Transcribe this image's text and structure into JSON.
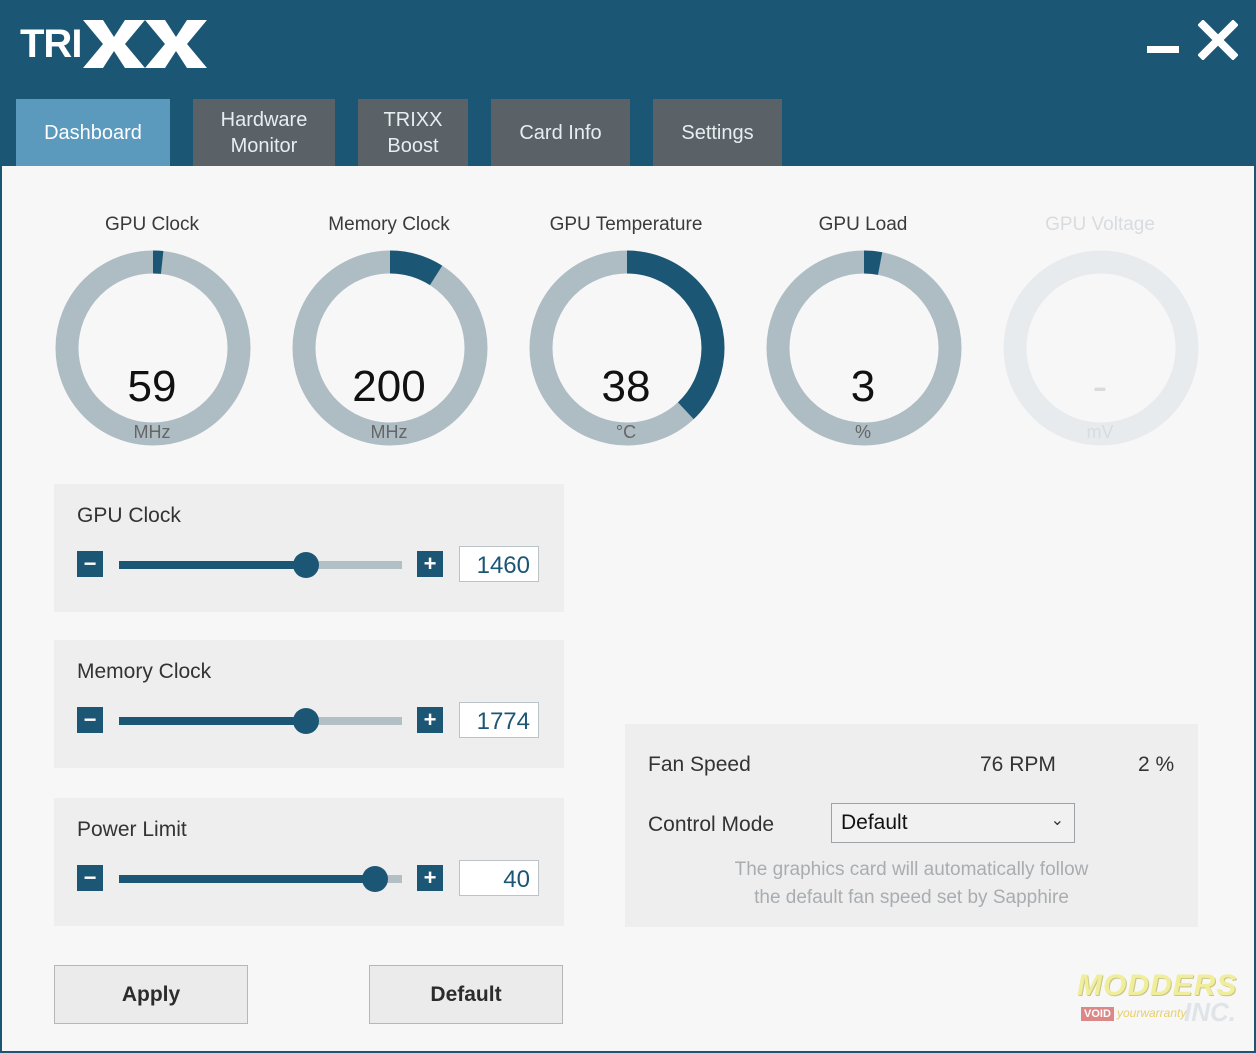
{
  "app": {
    "logo_text": "TRI",
    "logo_xx": "XX"
  },
  "window_controls": {
    "minimize_icon": "minimize-icon",
    "close_icon": "close-icon"
  },
  "tabs": [
    {
      "label": "Dashboard",
      "active": true
    },
    {
      "label": "Hardware\nMonitor",
      "active": false
    },
    {
      "label": "TRIXX\nBoost",
      "active": false
    },
    {
      "label": "Card Info",
      "active": false
    },
    {
      "label": "Settings",
      "active": false
    }
  ],
  "gauges": [
    {
      "title": "GPU Clock",
      "value": "59",
      "unit": "MHz",
      "fraction": 0.017
    },
    {
      "title": "Memory Clock",
      "value": "200",
      "unit": "MHz",
      "fraction": 0.09
    },
    {
      "title": "GPU Temperature",
      "value": "38",
      "unit": "°C",
      "fraction": 0.38
    },
    {
      "title": "GPU Load",
      "value": "3",
      "unit": "%",
      "fraction": 0.03
    },
    {
      "title": "GPU Voltage",
      "value": "-",
      "unit": "mV",
      "fraction": 0
    }
  ],
  "sliders": {
    "gpu_clock": {
      "label": "GPU Clock",
      "value": "1460",
      "fraction": 0.66
    },
    "memory_clock": {
      "label": "Memory Clock",
      "value": "1774",
      "fraction": 0.66
    },
    "power_limit": {
      "label": "Power Limit",
      "value": "40",
      "fraction": 0.905
    }
  },
  "stepper": {
    "minus": "−",
    "plus": "+"
  },
  "fan": {
    "label": "Fan Speed",
    "rpm": "76 RPM",
    "percent": "2 %",
    "control_mode_label": "Control Mode",
    "control_mode_value": "Default",
    "description_line1": "The graphics card will automatically follow",
    "description_line2": "the default fan speed set by Sapphire"
  },
  "buttons": {
    "apply": "Apply",
    "default": "Default"
  },
  "watermark": {
    "top": "MODDERS",
    "void": "VOID",
    "warranty": "yourwarranty",
    "inc": "INC."
  },
  "colors": {
    "header": "#1c5675",
    "tab_active": "#5b99bd",
    "tab_inactive": "#5a6268",
    "gauge_track": "#aebcc4",
    "gauge_fill": "#1c5675",
    "gauge_disabled": "#e8ebed"
  }
}
